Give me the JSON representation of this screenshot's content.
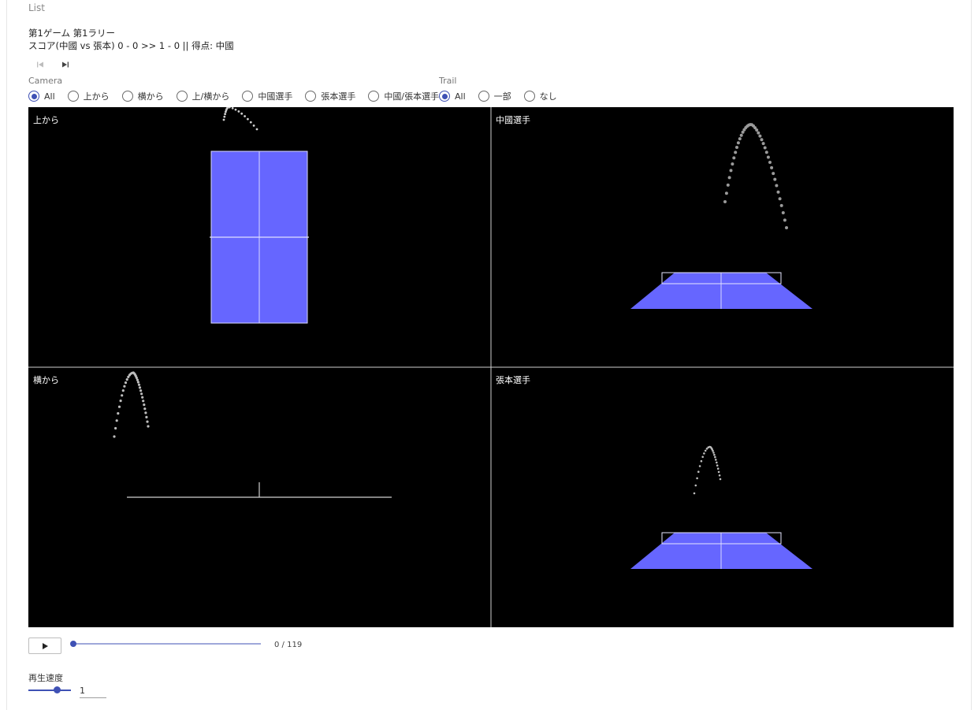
{
  "header": {
    "list_link": "List",
    "rally_title": "第1ゲーム 第1ラリー",
    "score_line": "スコア(中國 vs 張本) 0 - 0 >> 1 - 0 || 得点: 中國"
  },
  "camera": {
    "label": "Camera",
    "selected": "All",
    "options": [
      "All",
      "上から",
      "横から",
      "上/横から",
      "中國選手",
      "張本選手",
      "中國/張本選手"
    ]
  },
  "trail": {
    "label": "Trail",
    "selected": "All",
    "options": [
      "All",
      "一部",
      "なし"
    ]
  },
  "panes": {
    "top_left": "上から",
    "top_right": "中國選手",
    "bottom_left": "横から",
    "bottom_right": "張本選手"
  },
  "playback": {
    "frame_counter": "0 / 119",
    "progress_fraction": 0
  },
  "speed": {
    "label": "再生速度",
    "value": "1"
  },
  "colors": {
    "table": "#6666ff",
    "viewer_bg": "#000000",
    "accent": "#3f51b5"
  },
  "icons": {
    "prev": "skip-previous-icon",
    "next": "skip-next-icon",
    "play": "play-icon"
  }
}
